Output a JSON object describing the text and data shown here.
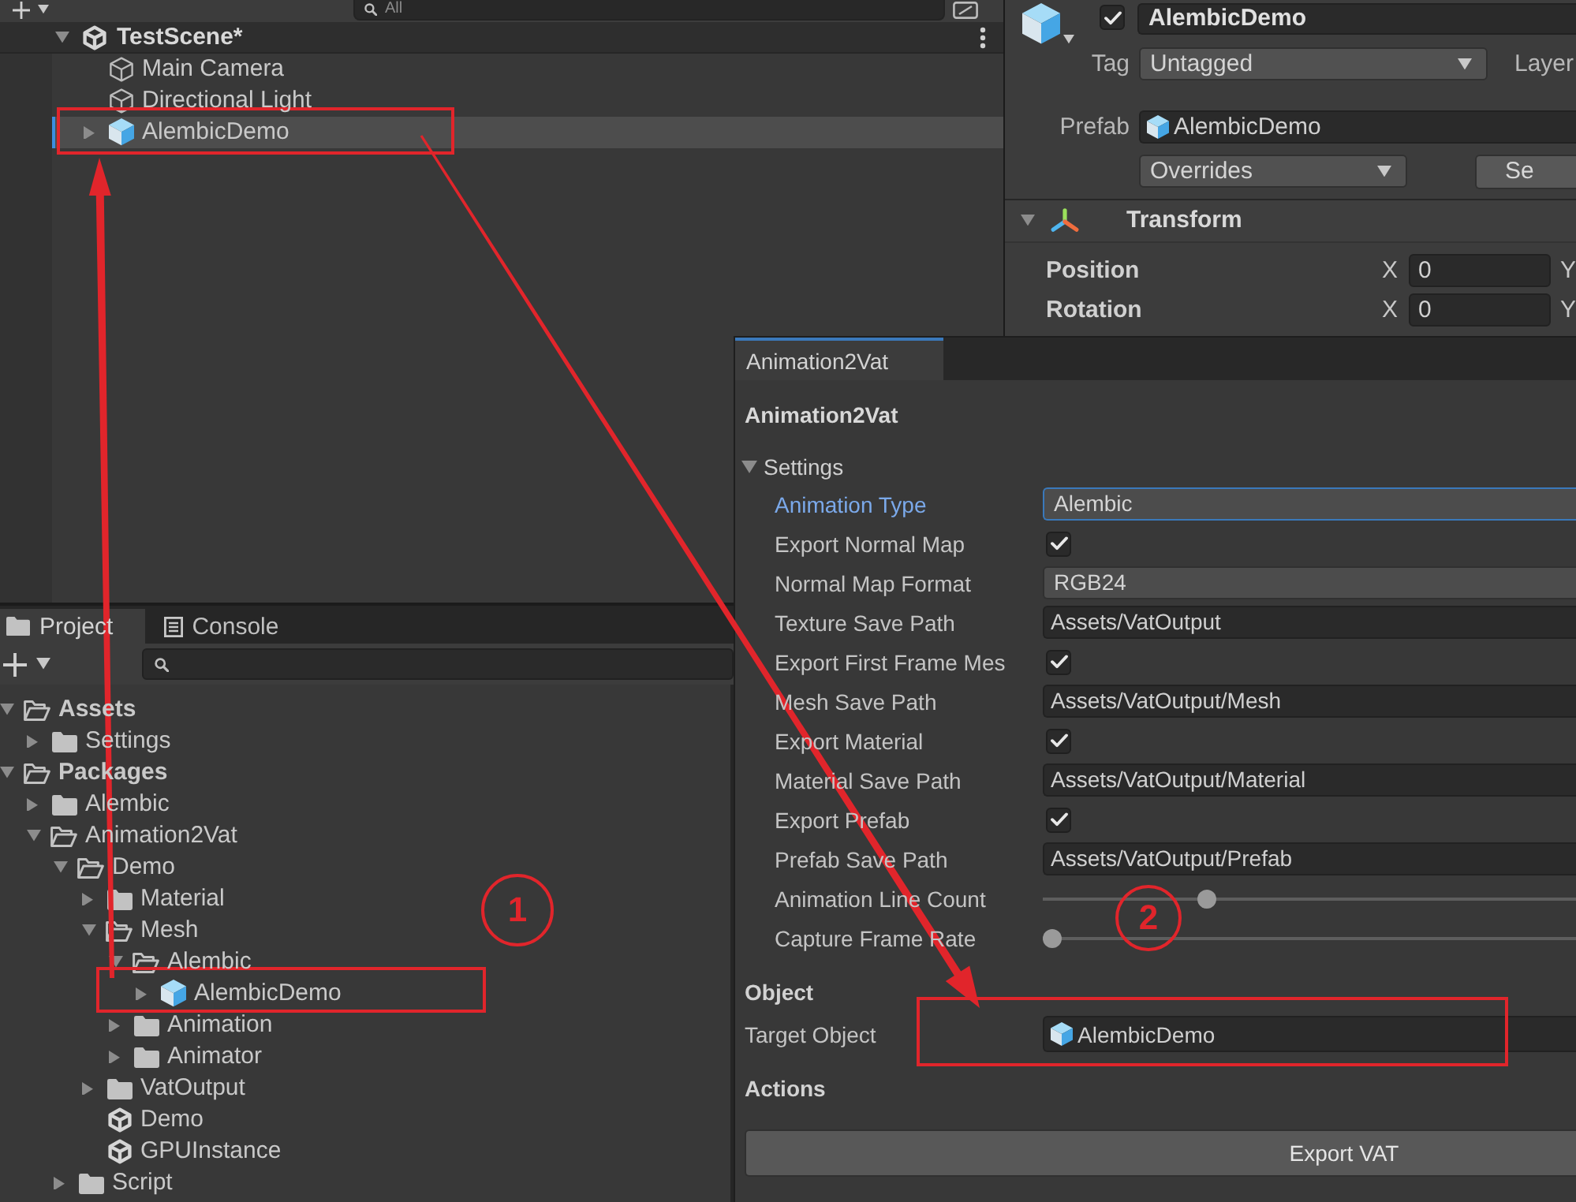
{
  "hierarchy": {
    "search": {
      "placeholder": "All"
    },
    "scene": {
      "name": "TestScene*",
      "expanded": true
    },
    "items": [
      {
        "name": "Main Camera",
        "kind": "gameobject",
        "selected": false,
        "modified": false
      },
      {
        "name": "Directional Light",
        "kind": "gameobject",
        "selected": false,
        "modified": false
      },
      {
        "name": "AlembicDemo",
        "kind": "prefab",
        "selected": true,
        "modified": true,
        "expanded": false
      }
    ]
  },
  "inspector": {
    "active": true,
    "name": "AlembicDemo",
    "tag": {
      "label": "Tag",
      "value": "Untagged"
    },
    "layer": {
      "label": "Layer"
    },
    "prefab": {
      "label": "Prefab",
      "value": "AlembicDemo"
    },
    "overrides": "Overrides",
    "select_button": "Se",
    "component": {
      "title": "Transform",
      "expanded": true,
      "rows": [
        {
          "label": "Position",
          "overridden": true,
          "axis": "X",
          "value": "0",
          "next_axis": "Y"
        },
        {
          "label": "Rotation",
          "overridden": true,
          "axis": "X",
          "value": "0",
          "next_axis": "Y"
        }
      ]
    }
  },
  "project": {
    "tabs": [
      {
        "label": "Project",
        "kind": "folder",
        "selected": true
      },
      {
        "label": "Console",
        "kind": "console",
        "selected": false
      }
    ],
    "tree": [
      {
        "name": "Assets",
        "kind": "folder",
        "expanded": true,
        "children": [
          {
            "name": "Settings",
            "kind": "folder",
            "expanded": false
          }
        ]
      },
      {
        "name": "Packages",
        "kind": "folder",
        "expanded": true,
        "children": [
          {
            "name": "Alembic",
            "kind": "folder",
            "expanded": false
          },
          {
            "name": "Animation2Vat",
            "kind": "folder",
            "expanded": true,
            "children": [
              {
                "name": "Demo",
                "kind": "folder",
                "expanded": true,
                "children": [
                  {
                    "name": "Material",
                    "kind": "folder",
                    "expanded": false
                  },
                  {
                    "name": "Mesh",
                    "kind": "folder",
                    "expanded": true,
                    "children": [
                      {
                        "name": "Alembic",
                        "kind": "folder",
                        "expanded": true,
                        "children": [
                          {
                            "name": "AlembicDemo",
                            "kind": "prefab",
                            "expanded": false
                          }
                        ]
                      },
                      {
                        "name": "Animation",
                        "kind": "folder",
                        "expanded": false
                      },
                      {
                        "name": "Animator",
                        "kind": "folder",
                        "expanded": false
                      }
                    ]
                  },
                  {
                    "name": "VatOutput",
                    "kind": "folder",
                    "expanded": false
                  },
                  {
                    "name": "Demo",
                    "kind": "scene"
                  },
                  {
                    "name": "GPUInstance",
                    "kind": "scene"
                  }
                ]
              },
              {
                "name": "Script",
                "kind": "folder",
                "expanded": false
              }
            ]
          }
        ]
      }
    ]
  },
  "tool_window": {
    "tab": {
      "label": "Animation2Vat",
      "selected": true
    },
    "title": "Animation2Vat",
    "settings": {
      "label": "Settings",
      "expanded": true,
      "fields": [
        {
          "kind": "dropdown",
          "label": "Animation Type",
          "value": "Alembic",
          "focused": true
        },
        {
          "kind": "checkbox",
          "label": "Export Normal Map",
          "checked": true,
          "focused": false
        },
        {
          "kind": "dropdown",
          "label": "Normal Map Format",
          "value": "RGB24",
          "focused": false
        },
        {
          "kind": "text",
          "label": "Texture Save Path",
          "value": "Assets/VatOutput",
          "focused": false
        },
        {
          "kind": "checkbox",
          "label": "Export First Frame Mes",
          "checked": true,
          "focused": false
        },
        {
          "kind": "text",
          "label": "Mesh Save Path",
          "value": "Assets/VatOutput/Mesh",
          "focused": false
        },
        {
          "kind": "checkbox",
          "label": "Export Material",
          "checked": true,
          "focused": false
        },
        {
          "kind": "text",
          "label": "Material Save Path",
          "value": "Assets/VatOutput/Material",
          "focused": false
        },
        {
          "kind": "checkbox",
          "label": "Export Prefab",
          "checked": true,
          "focused": false
        },
        {
          "kind": "text",
          "label": "Prefab Save Path",
          "value": "Assets/VatOutput/Prefab",
          "focused": false
        },
        {
          "kind": "slider",
          "label": "Animation Line Count",
          "level": 0.3,
          "focused": false
        },
        {
          "kind": "slider",
          "label": "Capture Frame Rate",
          "level": 0,
          "focused": false
        }
      ]
    },
    "sections": [
      {
        "title": "Object",
        "fields": [
          {
            "kind": "object",
            "label": "Target Object",
            "value": "AlembicDemo",
            "focused": false
          }
        ]
      },
      {
        "title": "Actions",
        "buttons": [
          "Export VAT"
        ]
      }
    ]
  },
  "annotations": {
    "callouts": [
      {
        "label": "1"
      },
      {
        "label": "2"
      }
    ]
  }
}
